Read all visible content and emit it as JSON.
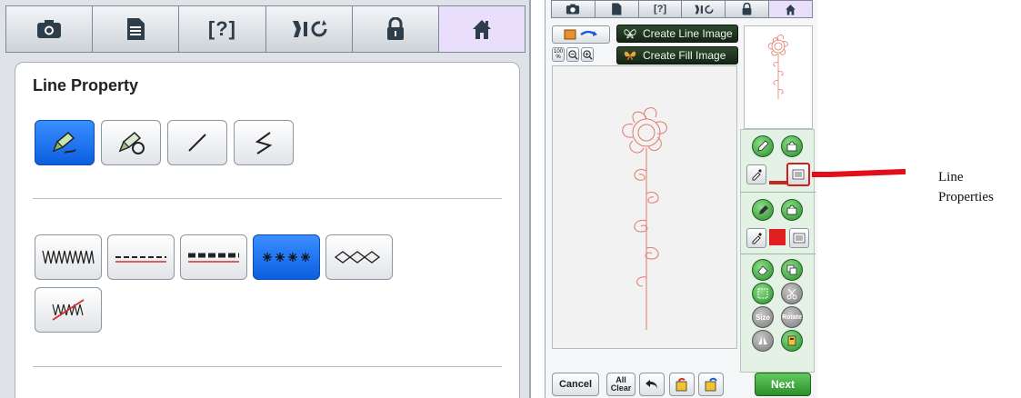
{
  "left_screen": {
    "tabs": [
      {
        "icon": "camera-icon"
      },
      {
        "icon": "document-icon"
      },
      {
        "icon": "help-icon",
        "label": "[?]"
      },
      {
        "icon": "bobbin-refresh-icon"
      },
      {
        "icon": "lock-icon"
      },
      {
        "icon": "home-icon",
        "active": true
      }
    ],
    "title": "Line Property",
    "line_tools": [
      {
        "icon": "pen-line-icon",
        "selected": true
      },
      {
        "icon": "pen-fill-icon"
      },
      {
        "icon": "straight-line-icon"
      },
      {
        "icon": "zigzag-line-icon"
      }
    ],
    "stitch_types": [
      {
        "icon": "zigzag-stitch-icon"
      },
      {
        "icon": "running-stitch-icon"
      },
      {
        "icon": "triple-stitch-icon"
      },
      {
        "icon": "candlewicking-stitch-icon",
        "selected": true
      },
      {
        "icon": "chain-stitch-icon"
      },
      {
        "icon": "no-sew-icon"
      }
    ]
  },
  "right_screen": {
    "create_line_label": "Create Line Image",
    "create_fill_label": "Create Fill Image",
    "zoom_label": "100 %",
    "cancel_label": "Cancel",
    "all_clear_line1": "All",
    "all_clear_line2": "Clear",
    "next_label": "Next",
    "size_label": "Size",
    "rotate_label": "Rotate",
    "fill_color": "#e02020",
    "line_color": "#c62828",
    "drawing_color": "#e07a6a"
  },
  "callout": {
    "text_line1": "Line",
    "text_line2": "Properties",
    "arrow_color": "#e10f1a"
  }
}
